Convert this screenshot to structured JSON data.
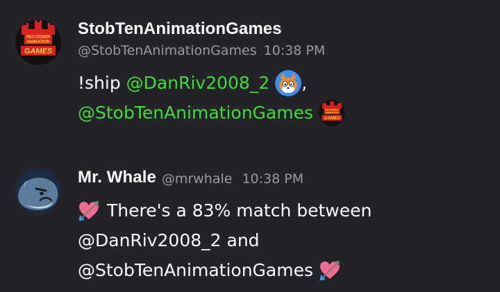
{
  "messages": [
    {
      "display_name": "StobTenAnimationGames",
      "handle": "@StobTenAnimationGames",
      "time": "10:38 PM",
      "avatar_icon": "red-castle-logo-icon",
      "avatar_text": [
        "RECORDER",
        "ANIMATION",
        "GAMES"
      ],
      "body": {
        "prefix": "!ship",
        "mention_1": "@DanRiv2008_2",
        "separator": ",",
        "mention_2": "@StobTenAnimationGames"
      }
    },
    {
      "display_name": "Mr. Whale",
      "handle": "@mrwhale",
      "time": "10:38 PM",
      "avatar_icon": "angry-whale-icon",
      "body": {
        "emoji": "heart-with-arrow-icon",
        "line_1": "There's a 83% match between",
        "line_2": "@DanRiv2008_2 and",
        "line_3": "@StobTenAnimationGames"
      }
    }
  ],
  "colors": {
    "background": "#242327",
    "mention": "#3ddc3d",
    "muted": "#9a999e",
    "heart": "#f06c92"
  }
}
